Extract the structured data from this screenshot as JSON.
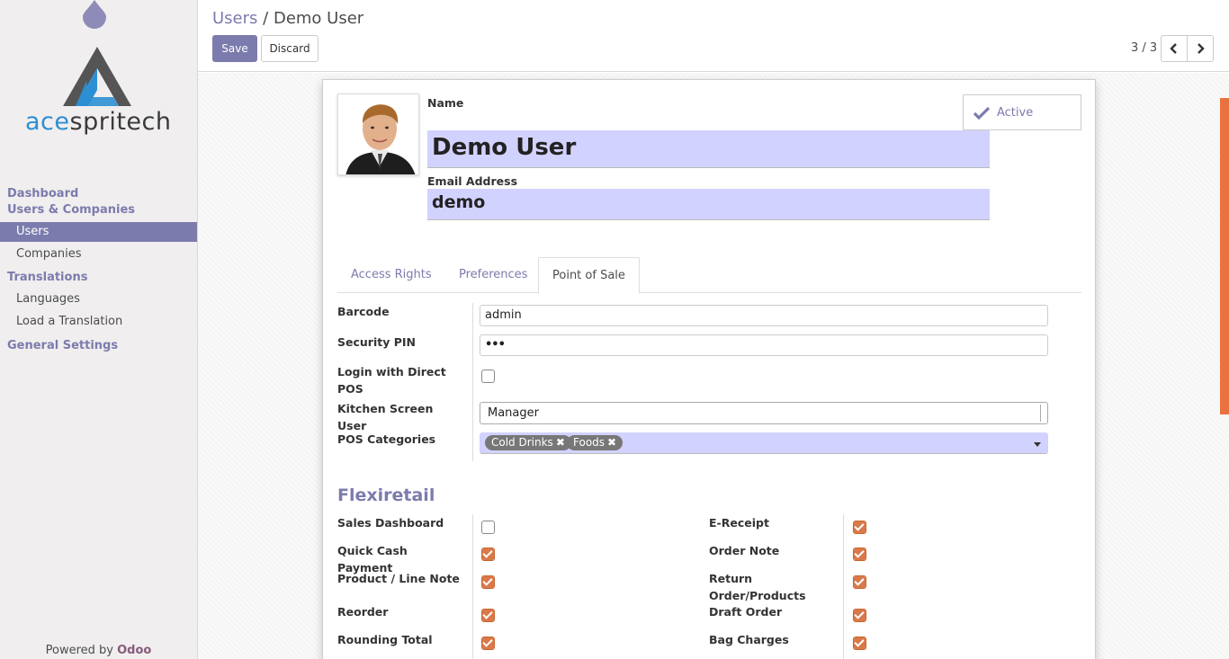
{
  "app": {
    "powered_prefix": "Powered by",
    "powered_brand": "Odoo"
  },
  "brand": {
    "logo_text_prefix": "ace",
    "logo_text_rest": "spritech"
  },
  "sidebar": {
    "groups": [
      {
        "head": "Dashboard"
      },
      {
        "head": "Users & Companies",
        "items": [
          "Users",
          "Companies"
        ]
      },
      {
        "head": "Translations",
        "items": [
          "Languages",
          "Load a Translation"
        ]
      },
      {
        "head": "General Settings"
      }
    ],
    "active_item": "Users"
  },
  "header": {
    "breadcrumb_parent": "Users",
    "breadcrumb_sep": "/",
    "breadcrumb_current": "Demo User",
    "save_label": "Save",
    "discard_label": "Discard",
    "pager": "3 / 3"
  },
  "form": {
    "name_label": "Name",
    "name_value": "Demo User",
    "email_label": "Email Address",
    "email_value": "demo",
    "active_label": "Active",
    "tabs": [
      "Access Rights",
      "Preferences",
      "Point of Sale"
    ],
    "active_tab": "Point of Sale",
    "pos": {
      "barcode_label": "Barcode",
      "barcode_value": "admin",
      "pin_label": "Security PIN",
      "pin_value": "•••",
      "direct_pos_label": "Login with Direct POS",
      "direct_pos_checked": false,
      "kitchen_label": "Kitchen Screen User",
      "kitchen_value": "Manager",
      "categories_label": "POS Categories",
      "categories": [
        "Cold Drinks",
        "Foods"
      ]
    },
    "flexiretail": {
      "title": "Flexiretail",
      "left": [
        {
          "label": "Sales Dashboard",
          "checked": false
        },
        {
          "label": "Quick Cash Payment",
          "checked": true
        },
        {
          "label": "Product / Line Note",
          "checked": true
        },
        {
          "label": "Reorder",
          "checked": true
        },
        {
          "label": "Rounding Total",
          "checked": true
        }
      ],
      "right": [
        {
          "label": "E-Receipt",
          "checked": true
        },
        {
          "label": "Order Note",
          "checked": true
        },
        {
          "label": "Return Order/Products",
          "checked": true
        },
        {
          "label": "Draft Order",
          "checked": true
        },
        {
          "label": "Bag Charges",
          "checked": true
        }
      ]
    }
  },
  "colors": {
    "accent": "#7c7bad",
    "input_highlight": "#d2d2ff",
    "checkbox_checked": "#d9794b"
  }
}
